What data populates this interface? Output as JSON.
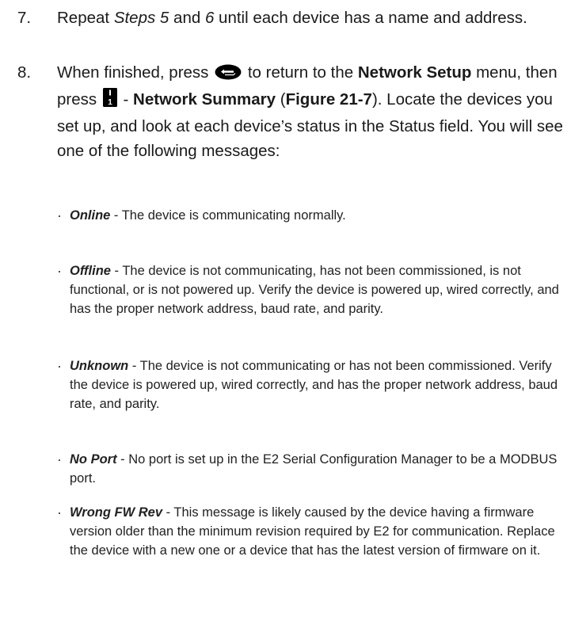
{
  "step7": {
    "number": "7.",
    "repeat": "Repeat ",
    "steps5": "Steps 5",
    "and": " and ",
    "six": "6",
    "rest": " until each device has a name and address."
  },
  "step8": {
    "number": "8.",
    "a": "When finished, press ",
    "b": " to return to the ",
    "network": "Network",
    "setup": "Setup",
    "c": " menu, then press ",
    "key_label": "1",
    "d": " - ",
    "summary": "Network Summary",
    "e": " (",
    "figure": "Figure 21-7",
    "f": "). Locate the devices you set up, and look at each device’s status in the Status field. You will see one of the following messages:"
  },
  "statuses": [
    {
      "term": "Online",
      "desc": " - The device is communicating normally."
    },
    {
      "term": "Offline",
      "desc": " - The device is not communicating, has not been commissioned, is not functional, or is not powered up. Verify the device is powered up, wired correctly, and has the proper network address, baud rate, and parity."
    },
    {
      "term": "Unknown",
      "desc": " - The device is not communicating or has not been commissioned. Verify the device is powered up, wired correctly, and has the proper network address, baud rate, and parity."
    },
    {
      "term": "No Port",
      "desc": " - No port is set up in the E2 Serial Configuration Manager to be a MODBUS port."
    },
    {
      "term": "Wrong FW Rev",
      "desc": " - This message is likely caused by the device having a firmware version older than the minimum revision required by E2 for communication. Replace the device with a new one or a device that has the latest version of firmware on it."
    }
  ],
  "icons": {
    "back_key": "back-key-icon",
    "number_key": "number-1-key-icon"
  },
  "colors": {
    "text": "#1a1a1a",
    "key_fill": "#000000"
  }
}
